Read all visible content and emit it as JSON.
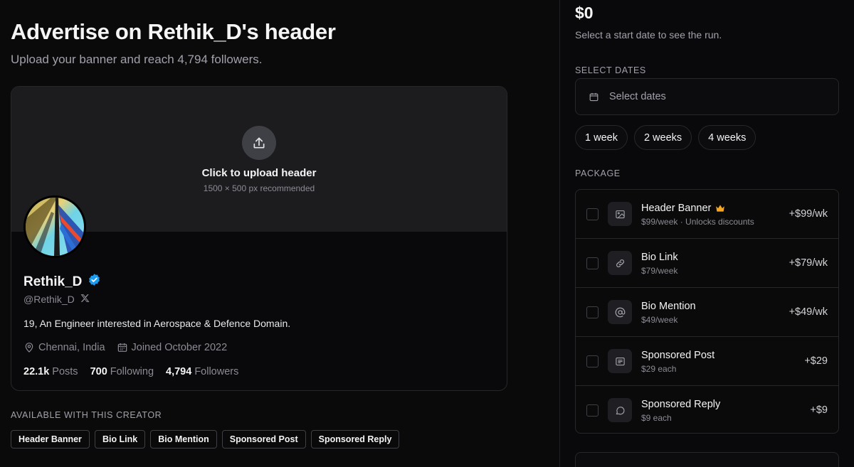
{
  "header": {
    "title": "Advertise on Rethik_D's header",
    "subtitle": "Upload your banner and reach 4,794 followers."
  },
  "upload": {
    "title": "Click to upload header",
    "hint": "1500 × 500 px recommended"
  },
  "profile": {
    "name": "Rethik_D",
    "handle": "@Rethik_D",
    "bio": "19, An Engineer interested in Aerospace & Defence Domain.",
    "location": "Chennai, India",
    "joined": "Joined October 2022",
    "stats": {
      "posts_value": "22.1k",
      "posts_label": "Posts",
      "following_value": "700",
      "following_label": "Following",
      "followers_value": "4,794",
      "followers_label": "Followers"
    }
  },
  "available": {
    "label": "AVAILABLE WITH THIS CREATOR",
    "items": [
      "Header Banner",
      "Bio Link",
      "Bio Mention",
      "Sponsored Post",
      "Sponsored Reply"
    ]
  },
  "order": {
    "total": "$0",
    "hint": "Select a start date to see the run.",
    "dates_label": "SELECT DATES",
    "dates_placeholder": "Select dates",
    "durations": [
      "1 week",
      "2 weeks",
      "4 weeks"
    ],
    "package_label": "PACKAGE",
    "packages": [
      {
        "name": "Header Banner",
        "sub": "$99/week · Unlocks discounts",
        "price": "+$99/wk",
        "icon": "image-icon",
        "checked": false
      },
      {
        "name": "Bio Link",
        "sub": "$79/week",
        "price": "+$79/wk",
        "icon": "link-icon",
        "checked": false
      },
      {
        "name": "Bio Mention",
        "sub": "$49/week",
        "price": "+$49/wk",
        "icon": "at-sign-icon",
        "checked": false
      },
      {
        "name": "Sponsored Post",
        "sub": "$29 each",
        "price": "+$29",
        "icon": "post-icon",
        "checked": false
      },
      {
        "name": "Sponsored Reply",
        "sub": "$9 each",
        "price": "+$9",
        "icon": "reply-icon",
        "checked": false
      }
    ]
  },
  "colors": {
    "verified": "#1d9bf0",
    "crown": "#f5a623",
    "background": "#0a0a0b"
  }
}
